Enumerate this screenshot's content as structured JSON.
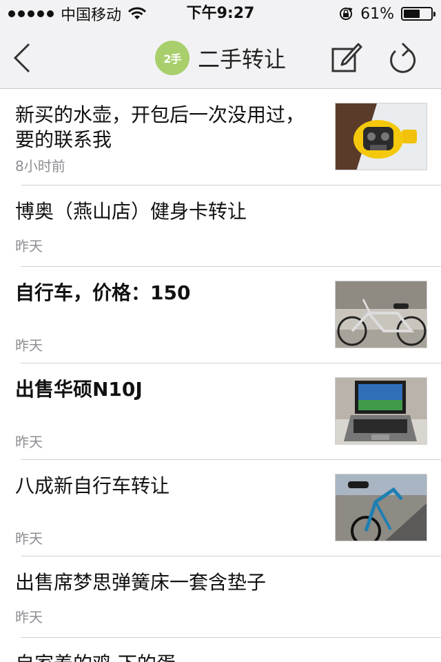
{
  "status_bar": {
    "carrier": "中国移动",
    "time": "下午9:27",
    "battery_percent_label": "61%",
    "battery_level": 0.61,
    "icons": [
      "signal-dots",
      "wifi-icon",
      "rotation-lock-icon",
      "battery-icon"
    ]
  },
  "nav": {
    "back_icon": "chevron-left-icon",
    "logo_text": "2手",
    "title": "二手转让",
    "edit_icon": "compose-icon",
    "refresh_icon": "refresh-icon",
    "logo_color": "#a8cf6c"
  },
  "feed": [
    {
      "title": "新买的水壶，开包后一次没用过，要的联系我",
      "time": "8小时前",
      "thumb": "kettle"
    },
    {
      "title": "博奥（燕山店）健身卡转让",
      "time": "昨天",
      "thumb": null
    },
    {
      "title": "自行车，价格：150",
      "time": "昨天",
      "thumb": "bicycle"
    },
    {
      "title": "出售华硕N10J",
      "time": "昨天",
      "thumb": "laptop"
    },
    {
      "title": "八成新自行车转让",
      "time": "昨天",
      "thumb": "bicycle-blue"
    },
    {
      "title": "出售席梦思弹簧床一套含垫子",
      "time": "昨天",
      "thumb": null
    },
    {
      "title": "自家养的鸡 下的蛋",
      "time": "",
      "thumb": null
    }
  ]
}
